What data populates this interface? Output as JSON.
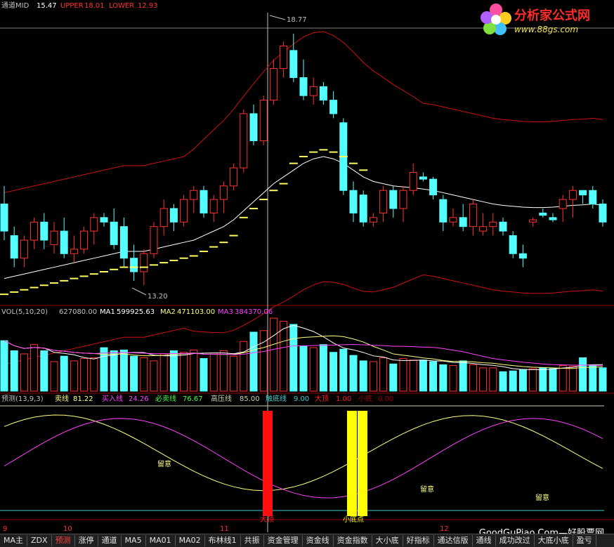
{
  "colors": {
    "up": "#ff3030",
    "down": "#54ffff",
    "mid": "#ffffff",
    "upper": "#cc1010",
    "lower": "#cc1010",
    "ma1": "#ffffff",
    "ma2": "#ffff80",
    "ma3": "#ff40ff",
    "signal_red": "#ff1010",
    "signal_yellow": "#ffff00"
  },
  "main_header": {
    "name": "通道MID",
    "mid": "15.47",
    "upper_label": "UPPER",
    "upper": "18.01",
    "lower_label": "LOWER",
    "lower": "12.93"
  },
  "vol_header": {
    "name": "VOL(5,10,20)",
    "vol": "627080.00",
    "ma1_label": "MA1",
    "ma1": "599925.63",
    "ma2_label": "MA2",
    "ma2": "471103.00",
    "ma3_label": "MA3",
    "ma3": "384370.06"
  },
  "ind_header": {
    "name": "预测(13,9,3)",
    "sell_label": "卖线",
    "sell": "81.22",
    "buy_label": "买入线",
    "buy": "24.26",
    "must_sell_label": "必卖线",
    "must_sell": "76.67",
    "high_label": "高压线",
    "high": "85.00",
    "bottom_label": "触底线",
    "bottom": "9.00",
    "top_label": "大顶",
    "top": "1.00",
    "small_label": "小底",
    "small": "0.00"
  },
  "annotations": {
    "high_price": "18.77",
    "low_price": "13.20",
    "notice": "留意",
    "big_top": "大顶",
    "small_bottom": "小底点"
  },
  "x_labels": [
    "9",
    "10",
    "11",
    "12"
  ],
  "tabs": [
    "MA主",
    "ZDX",
    "预测",
    "涨停",
    "通道",
    "MA5",
    "MA01",
    "MA02",
    "布林线1",
    "共振",
    "资金管理",
    "资金线",
    "资金指数",
    "大小底",
    "好指标",
    "通达信版",
    "通线",
    "成功改过",
    "大底小底",
    "盈亏"
  ],
  "active_tab": "预测",
  "logo": {
    "name": "分析家公式网",
    "url": "www.88gs.com"
  },
  "watermark": "GoodGuPiao.Com—好股票网",
  "chart_data": {
    "type": "candlestick",
    "y_range": [
      12.8,
      19.3
    ],
    "candles": [
      [
        15.0,
        15.4,
        14.2,
        14.4
      ],
      [
        14.3,
        14.5,
        13.6,
        13.8
      ],
      [
        13.8,
        14.3,
        13.6,
        14.2
      ],
      [
        14.2,
        14.7,
        14.0,
        14.6
      ],
      [
        14.6,
        14.8,
        14.0,
        14.2
      ],
      [
        14.1,
        14.6,
        13.9,
        14.4
      ],
      [
        14.4,
        14.7,
        13.8,
        13.9
      ],
      [
        13.9,
        14.3,
        13.7,
        14.0
      ],
      [
        14.0,
        14.5,
        13.9,
        14.4
      ],
      [
        14.4,
        14.8,
        14.1,
        14.7
      ],
      [
        14.7,
        14.8,
        14.5,
        14.6
      ],
      [
        14.6,
        14.9,
        14.0,
        14.1
      ],
      [
        14.5,
        14.7,
        13.6,
        13.8
      ],
      [
        13.8,
        14.1,
        13.3,
        13.5
      ],
      [
        13.5,
        14.0,
        13.2,
        13.9
      ],
      [
        13.9,
        14.6,
        13.8,
        14.5
      ],
      [
        14.5,
        15.1,
        14.3,
        14.9
      ],
      [
        14.9,
        15.0,
        14.4,
        14.6
      ],
      [
        14.6,
        15.2,
        14.5,
        15.1
      ],
      [
        15.1,
        15.4,
        14.8,
        15.3
      ],
      [
        15.3,
        15.4,
        14.7,
        14.8
      ],
      [
        14.8,
        15.2,
        14.6,
        15.1
      ],
      [
        15.1,
        15.5,
        14.8,
        15.4
      ],
      [
        15.4,
        15.9,
        15.3,
        15.8
      ],
      [
        15.8,
        17.1,
        15.7,
        17.0
      ],
      [
        17.0,
        17.2,
        16.3,
        16.4
      ],
      [
        16.4,
        17.4,
        16.3,
        17.3
      ],
      [
        17.3,
        18.2,
        17.2,
        18.0
      ],
      [
        18.0,
        18.6,
        17.8,
        18.5
      ],
      [
        18.4,
        18.77,
        17.7,
        17.8
      ],
      [
        17.8,
        18.2,
        17.3,
        17.4
      ],
      [
        17.4,
        17.8,
        17.2,
        17.6
      ],
      [
        17.6,
        17.7,
        17.2,
        17.3
      ],
      [
        17.3,
        17.5,
        16.9,
        17.0
      ],
      [
        16.8,
        16.9,
        15.2,
        15.3
      ],
      [
        15.3,
        15.5,
        14.6,
        14.8
      ],
      [
        15.2,
        15.3,
        14.5,
        14.6
      ],
      [
        14.6,
        14.8,
        14.5,
        14.7
      ],
      [
        14.8,
        15.4,
        14.6,
        15.3
      ],
      [
        15.3,
        15.4,
        14.7,
        14.9
      ],
      [
        14.9,
        15.4,
        14.6,
        15.3
      ],
      [
        15.3,
        15.9,
        15.2,
        15.7
      ],
      [
        15.6,
        15.7,
        15.5,
        15.55
      ],
      [
        15.55,
        15.6,
        15.1,
        15.2
      ],
      [
        15.1,
        15.2,
        14.4,
        14.6
      ],
      [
        14.6,
        14.9,
        14.5,
        14.7
      ],
      [
        14.7,
        15.0,
        14.4,
        14.5
      ],
      [
        14.5,
        15.1,
        14.3,
        15.0
      ],
      [
        14.4,
        14.8,
        14.3,
        14.5
      ],
      [
        14.5,
        14.8,
        14.3,
        14.6
      ],
      [
        14.6,
        14.7,
        14.3,
        14.4
      ],
      [
        14.3,
        14.4,
        13.8,
        13.9
      ],
      [
        13.9,
        14.1,
        13.6,
        13.8
      ],
      [
        14.6,
        14.7,
        14.5,
        14.65
      ],
      [
        14.8,
        14.9,
        14.7,
        14.75
      ],
      [
        14.7,
        14.8,
        14.6,
        14.65
      ],
      [
        14.9,
        15.2,
        14.6,
        15.1
      ],
      [
        15.1,
        15.4,
        14.7,
        15.3
      ],
      [
        15.3,
        15.3,
        15.0,
        15.2
      ],
      [
        15.3,
        15.4,
        14.9,
        15.0
      ],
      [
        15.0,
        15.1,
        14.5,
        14.6
      ]
    ],
    "volume_range": [
      0,
      950000
    ],
    "volumes": [
      650,
      520,
      480,
      600,
      520,
      380,
      450,
      390,
      420,
      430,
      560,
      520,
      530,
      450,
      430,
      390,
      480,
      520,
      500,
      530,
      420,
      490,
      520,
      450,
      640,
      760,
      780,
      940,
      900,
      860,
      580,
      560,
      600,
      500,
      540,
      460,
      390,
      380,
      430,
      350,
      420,
      400,
      400,
      380,
      340,
      330,
      390,
      340,
      300,
      300,
      250,
      260,
      280,
      290,
      300,
      290,
      330,
      320,
      430,
      330,
      300
    ],
    "mid_line": [
      13.35,
      13.4,
      13.45,
      13.5,
      13.55,
      13.6,
      13.65,
      13.7,
      13.75,
      13.8,
      13.85,
      13.9,
      13.95,
      13.95,
      13.95,
      14.0,
      14.05,
      14.1,
      14.15,
      14.2,
      14.3,
      14.4,
      14.5,
      14.65,
      14.85,
      15.05,
      15.25,
      15.45,
      15.6,
      15.75,
      15.9,
      16.0,
      16.05,
      16.0,
      15.9,
      15.75,
      15.6,
      15.5,
      15.45,
      15.4,
      15.38,
      15.36,
      15.33,
      15.3,
      15.25,
      15.2,
      15.15,
      15.1,
      15.05,
      15.0,
      14.97,
      14.95,
      14.93,
      14.92,
      14.92,
      14.93,
      14.95,
      14.97,
      14.98,
      15.0,
      14.97
    ]
  }
}
